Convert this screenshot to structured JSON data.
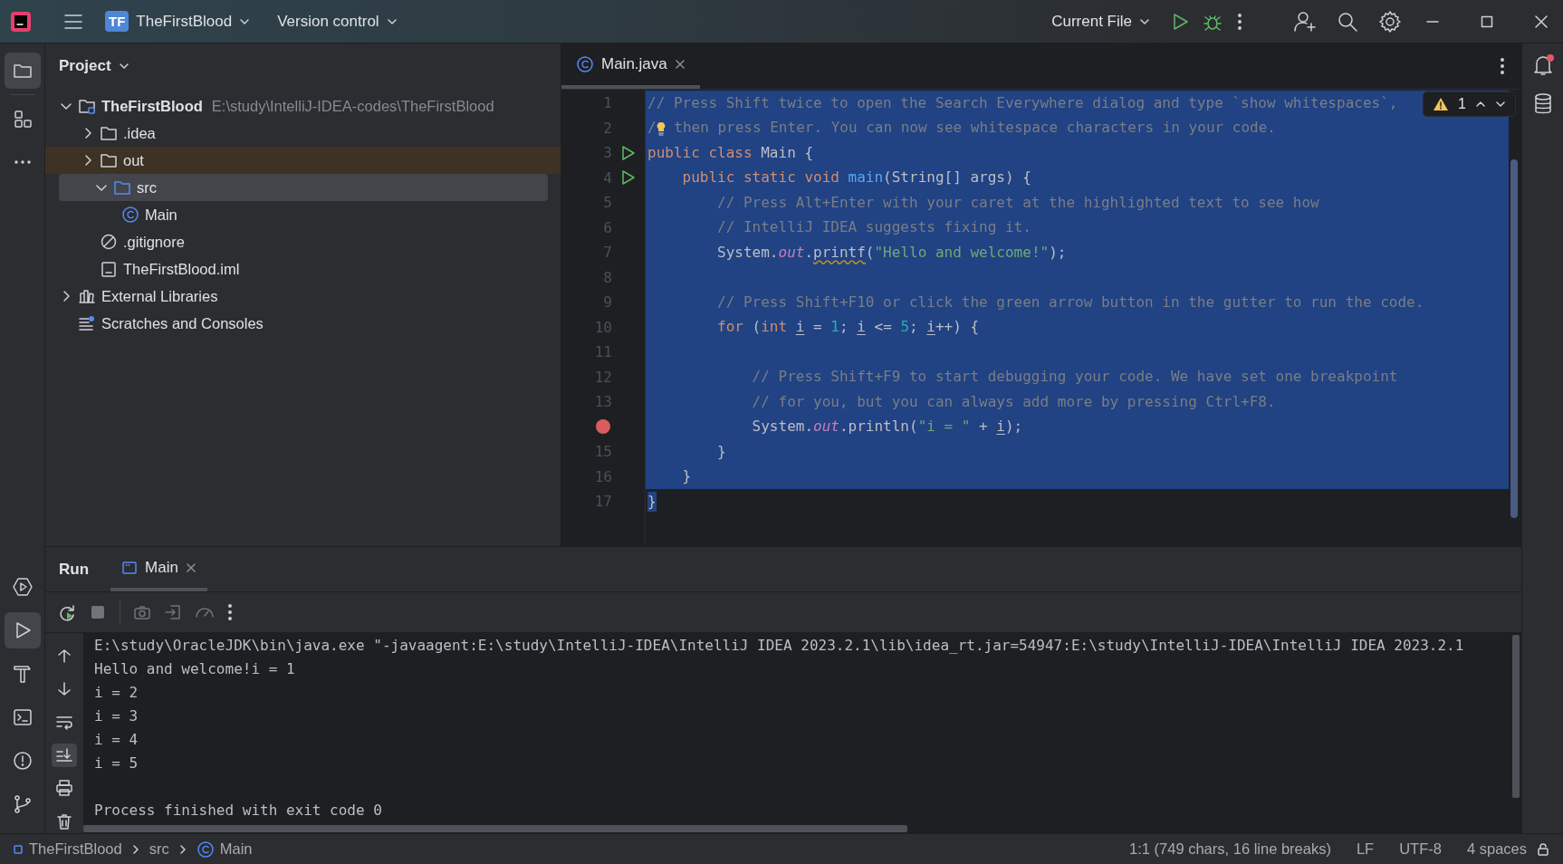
{
  "title_bar": {
    "project_badge": "TF",
    "project": "TheFirstBlood",
    "vcs": "Version control",
    "run_config": "Current File"
  },
  "left_toolbar": {
    "top": [
      {
        "kind": "folder",
        "selected": true
      },
      {
        "kind": "structure",
        "selected": false
      },
      {
        "kind": "more",
        "selected": false
      }
    ],
    "bottom": [
      {
        "kind": "services",
        "selected": false
      },
      {
        "kind": "run",
        "selected": true
      },
      {
        "kind": "hammer",
        "selected": false
      },
      {
        "kind": "terminal",
        "selected": false
      },
      {
        "kind": "problems",
        "selected": false
      },
      {
        "kind": "git",
        "selected": false
      }
    ]
  },
  "project_panel": {
    "title": "Project",
    "tree": [
      {
        "label": "TheFirstBlood",
        "path": "E:\\study\\IntelliJ-IDEA-codes\\TheFirstBlood",
        "kind": "module",
        "expanded": true,
        "selected": false,
        "excluded": false,
        "children": [
          {
            "label": ".idea",
            "kind": "folder",
            "expanded": false,
            "selected": false,
            "excluded": false
          },
          {
            "label": "out",
            "kind": "folder",
            "expanded": false,
            "selected": false,
            "excluded": true
          },
          {
            "label": "src",
            "kind": "source",
            "expanded": true,
            "selected": true,
            "excluded": false,
            "children": [
              {
                "label": "Main",
                "kind": "class",
                "selected": false,
                "excluded": false
              }
            ]
          },
          {
            "label": ".gitignore",
            "kind": "ignore",
            "selected": false,
            "excluded": false
          },
          {
            "label": "TheFirstBlood.iml",
            "kind": "iml",
            "selected": false,
            "excluded": false
          }
        ]
      },
      {
        "label": "External Libraries",
        "kind": "library",
        "expanded": false,
        "selected": false,
        "excluded": false
      },
      {
        "label": "Scratches and Consoles",
        "kind": "scratches",
        "selected": false,
        "excluded": false
      }
    ]
  },
  "editor": {
    "tabs": [
      {
        "label": "Main.java",
        "selected": true
      }
    ],
    "warnings": "1",
    "lines": [
      {
        "number": "1",
        "selected": true,
        "tokens": [
          {
            "kind": "comment",
            "text": "// Press Shift twice to open the Search Everywhere dialog and type `show whitespaces`,"
          }
        ]
      },
      {
        "number": "2",
        "selected": true,
        "tokens": [
          {
            "kind": "comment",
            "text": "/"
          },
          {
            "kind": "bulb"
          },
          {
            "kind": "comment",
            "text": " then press Enter. You can now see whitespace characters in your code."
          }
        ]
      },
      {
        "number": "3",
        "selected": true,
        "runnable": true,
        "tokens": [
          {
            "kind": "keyword",
            "text": "public class "
          },
          {
            "kind": "plain",
            "text": "Main {"
          }
        ]
      },
      {
        "number": "4",
        "selected": true,
        "runnable": true,
        "tokens": [
          {
            "kind": "keyword",
            "text": "    public static void "
          },
          {
            "kind": "decl",
            "text": "main"
          },
          {
            "kind": "plain",
            "text": "(String[] args) {"
          }
        ]
      },
      {
        "number": "5",
        "selected": true,
        "tokens": [
          {
            "kind": "comment",
            "text": "        // Press Alt+Enter with your caret at the highlighted text to see how"
          }
        ]
      },
      {
        "number": "6",
        "selected": true,
        "tokens": [
          {
            "kind": "comment",
            "text": "        // IntelliJ IDEA suggests fixing it."
          }
        ]
      },
      {
        "number": "7",
        "selected": true,
        "tokens": [
          {
            "kind": "plain",
            "text": "        System."
          },
          {
            "kind": "field",
            "text": "out"
          },
          {
            "kind": "plain",
            "text": "."
          },
          {
            "kind": "warning",
            "text": "printf"
          },
          {
            "kind": "plain",
            "text": "("
          },
          {
            "kind": "string",
            "text": "\"Hello and welcome!\""
          },
          {
            "kind": "plain",
            "text": ");"
          }
        ]
      },
      {
        "number": "8",
        "selected": true
      },
      {
        "number": "9",
        "selected": true,
        "tokens": [
          {
            "kind": "comment",
            "text": "        // Press Shift+F10 or click the green arrow button in the gutter to run the code."
          }
        ]
      },
      {
        "number": "10",
        "selected": true,
        "tokens": [
          {
            "kind": "keyword",
            "text": "        for "
          },
          {
            "kind": "plain",
            "text": "("
          },
          {
            "kind": "keyword",
            "text": "int "
          },
          {
            "kind": "var",
            "text": "i"
          },
          {
            "kind": "plain",
            "text": " = "
          },
          {
            "kind": "number",
            "text": "1"
          },
          {
            "kind": "plain",
            "text": "; "
          },
          {
            "kind": "var",
            "text": "i"
          },
          {
            "kind": "plain",
            "text": " <= "
          },
          {
            "kind": "number",
            "text": "5"
          },
          {
            "kind": "plain",
            "text": "; "
          },
          {
            "kind": "var",
            "text": "i"
          },
          {
            "kind": "plain",
            "text": "++) {"
          }
        ]
      },
      {
        "number": "11",
        "selected": true
      },
      {
        "number": "12",
        "selected": true,
        "tokens": [
          {
            "kind": "comment",
            "text": "            // Press Shift+F9 to start debugging your code. We have set one breakpoint"
          }
        ]
      },
      {
        "number": "13",
        "selected": true,
        "tokens": [
          {
            "kind": "comment",
            "text": "            // for you, but you can always add more by pressing Ctrl+F8."
          }
        ]
      },
      {
        "selected": true,
        "breakpoint": true,
        "tokens": [
          {
            "kind": "plain",
            "text": "            System."
          },
          {
            "kind": "field",
            "text": "out"
          },
          {
            "kind": "plain",
            "text": ".println("
          },
          {
            "kind": "string",
            "text": "\"i = \""
          },
          {
            "kind": "plain",
            "text": " + "
          },
          {
            "kind": "var",
            "text": "i"
          },
          {
            "kind": "plain",
            "text": ");"
          }
        ]
      },
      {
        "number": "15",
        "selected": true,
        "tokens": [
          {
            "kind": "plain",
            "text": "        }"
          }
        ]
      },
      {
        "number": "16",
        "selected": true,
        "tokens": [
          {
            "kind": "plain",
            "text": "    }"
          }
        ]
      },
      {
        "number": "17",
        "selected": true,
        "tokens": [
          {
            "kind": "plain",
            "text": "}"
          }
        ]
      }
    ]
  },
  "right_toolbar": {
    "notifications_unread": true
  },
  "run_panel": {
    "title": "Run",
    "tabs": [
      {
        "label": "Main",
        "selected": true
      }
    ],
    "console_tools": [
      {
        "kind": "up",
        "on": false
      },
      {
        "kind": "down",
        "on": false
      },
      {
        "kind": "wrap",
        "on": false
      },
      {
        "kind": "scroll-end",
        "on": true
      },
      {
        "kind": "print",
        "on": false
      },
      {
        "kind": "trash",
        "on": false
      }
    ],
    "console": [
      {
        "text": "E:\\study\\OracleJDK\\bin\\java.exe \"-javaagent:E:\\study\\IntelliJ-IDEA\\IntelliJ IDEA 2023.2.1\\lib\\idea_rt.jar=54947:E:\\study\\IntelliJ-IDEA\\IntelliJ IDEA 2023.2.1",
        "blank_before": false
      },
      {
        "text": "Hello and welcome!i = 1",
        "blank_before": false
      },
      {
        "text": "i = 2",
        "blank_before": false
      },
      {
        "text": "i = 3",
        "blank_before": false
      },
      {
        "text": "i = 4",
        "blank_before": false
      },
      {
        "text": "i = 5",
        "blank_before": false
      },
      {
        "text": "Process finished with exit code 0",
        "blank_before": true
      }
    ]
  },
  "status_bar": {
    "breadcrumbs": [
      {
        "label": "TheFirstBlood",
        "kind": "module"
      },
      {
        "label": "src",
        "kind": "folder"
      },
      {
        "label": "Main",
        "kind": "class"
      }
    ],
    "position": "1:1 (749 chars, 16 line breaks)",
    "line_separator": "LF",
    "encoding": "UTF-8",
    "indent": "4 spaces"
  }
}
